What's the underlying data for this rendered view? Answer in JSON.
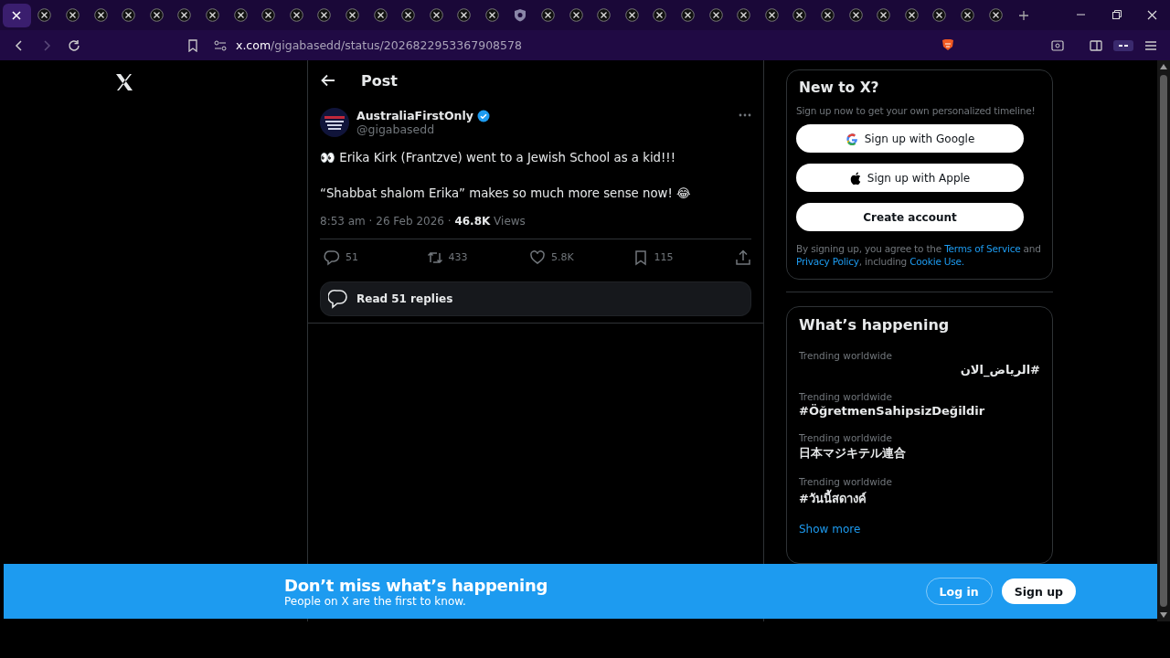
{
  "browser": {
    "tabs": [
      {
        "selected": true
      },
      {
        "kind": "x",
        "selected": false
      },
      {
        "kind": "x",
        "selected": false
      },
      {
        "kind": "x",
        "selected": false
      },
      {
        "kind": "x",
        "selected": false
      },
      {
        "kind": "x",
        "selected": false
      },
      {
        "kind": "x",
        "selected": false
      },
      {
        "kind": "x",
        "selected": false
      },
      {
        "kind": "x",
        "selected": false
      },
      {
        "kind": "x",
        "selected": false
      },
      {
        "kind": "x",
        "selected": false
      },
      {
        "kind": "x",
        "selected": false
      },
      {
        "kind": "x",
        "selected": false
      },
      {
        "kind": "x",
        "selected": false
      },
      {
        "kind": "x",
        "selected": false
      },
      {
        "kind": "x",
        "selected": false
      },
      {
        "kind": "x",
        "selected": false
      },
      {
        "kind": "x",
        "selected": false
      },
      {
        "kind": "shield",
        "selected": false
      },
      {
        "kind": "x",
        "selected": false
      },
      {
        "kind": "x",
        "selected": false
      },
      {
        "kind": "x",
        "selected": false
      },
      {
        "kind": "x",
        "selected": false
      },
      {
        "kind": "x",
        "selected": false
      },
      {
        "kind": "x",
        "selected": false
      },
      {
        "kind": "x",
        "selected": false
      },
      {
        "kind": "x",
        "selected": false
      },
      {
        "kind": "x",
        "selected": false
      },
      {
        "kind": "x",
        "selected": false
      },
      {
        "kind": "x",
        "selected": false
      },
      {
        "kind": "x",
        "selected": false
      },
      {
        "kind": "x",
        "selected": false
      },
      {
        "kind": "x",
        "selected": false
      },
      {
        "kind": "x",
        "selected": false
      },
      {
        "kind": "x",
        "selected": false
      },
      {
        "kind": "x",
        "selected": false
      }
    ],
    "url_host": "x.com",
    "url_path": "/gigabasedd/status/2026822953367908578"
  },
  "post": {
    "header": "Post",
    "author": {
      "name": "AustraliaFirstOnly",
      "handle": "@gigabasedd",
      "verified": true
    },
    "paragraphs": [
      "👀 Erika Kirk (Frantzve) went to a Jewish School as a kid!!!",
      "“Shabbat shalom Erika” makes so much more sense now! 😂"
    ],
    "meta": "8:53 am · 26 Feb 2026 · **46.8K** Views",
    "actions": [
      {
        "kind": "reply",
        "count": "51"
      },
      {
        "kind": "repost",
        "count": "433"
      },
      {
        "kind": "like",
        "count": "5.8K"
      },
      {
        "kind": "bookmark",
        "count": "115"
      },
      {
        "kind": "share"
      }
    ],
    "read_replies": "Read 51 replies"
  },
  "signup": {
    "title": "New to X?",
    "subtitle": "Sign up now to get your own personalized timeline!",
    "buttons": [
      {
        "kind": "google",
        "label": "Sign up with Google"
      },
      {
        "kind": "apple",
        "label": "Sign up with Apple"
      },
      {
        "kind": "plain",
        "label": "Create account"
      }
    ],
    "legal": [
      {
        "text": "By signing up, you agree to the ",
        "link": false
      },
      {
        "text": "Terms of Service",
        "link": true
      },
      {
        "text": " and ",
        "link": false
      },
      {
        "text": "Privacy Policy",
        "link": true
      },
      {
        "text": ", including ",
        "link": false
      },
      {
        "text": "Cookie Use.",
        "link": true
      }
    ]
  },
  "trends": {
    "title": "What’s happening",
    "items": [
      {
        "label": "Trending worldwide",
        "topic": "#الرياض_الان"
      },
      {
        "label": "Trending worldwide",
        "topic": "#ÖğretmenSahipsizDeğildir"
      },
      {
        "label": "Trending worldwide",
        "topic": "日本マジキテル連合"
      },
      {
        "label": "Trending worldwide",
        "topic": "#วันนี้สดางค์"
      }
    ],
    "show_more": "Show more"
  },
  "banner": {
    "title": "Don’t miss what’s happening",
    "subtitle": "People on X are the first to know.",
    "login": "Log in",
    "signup": "Sign up"
  }
}
